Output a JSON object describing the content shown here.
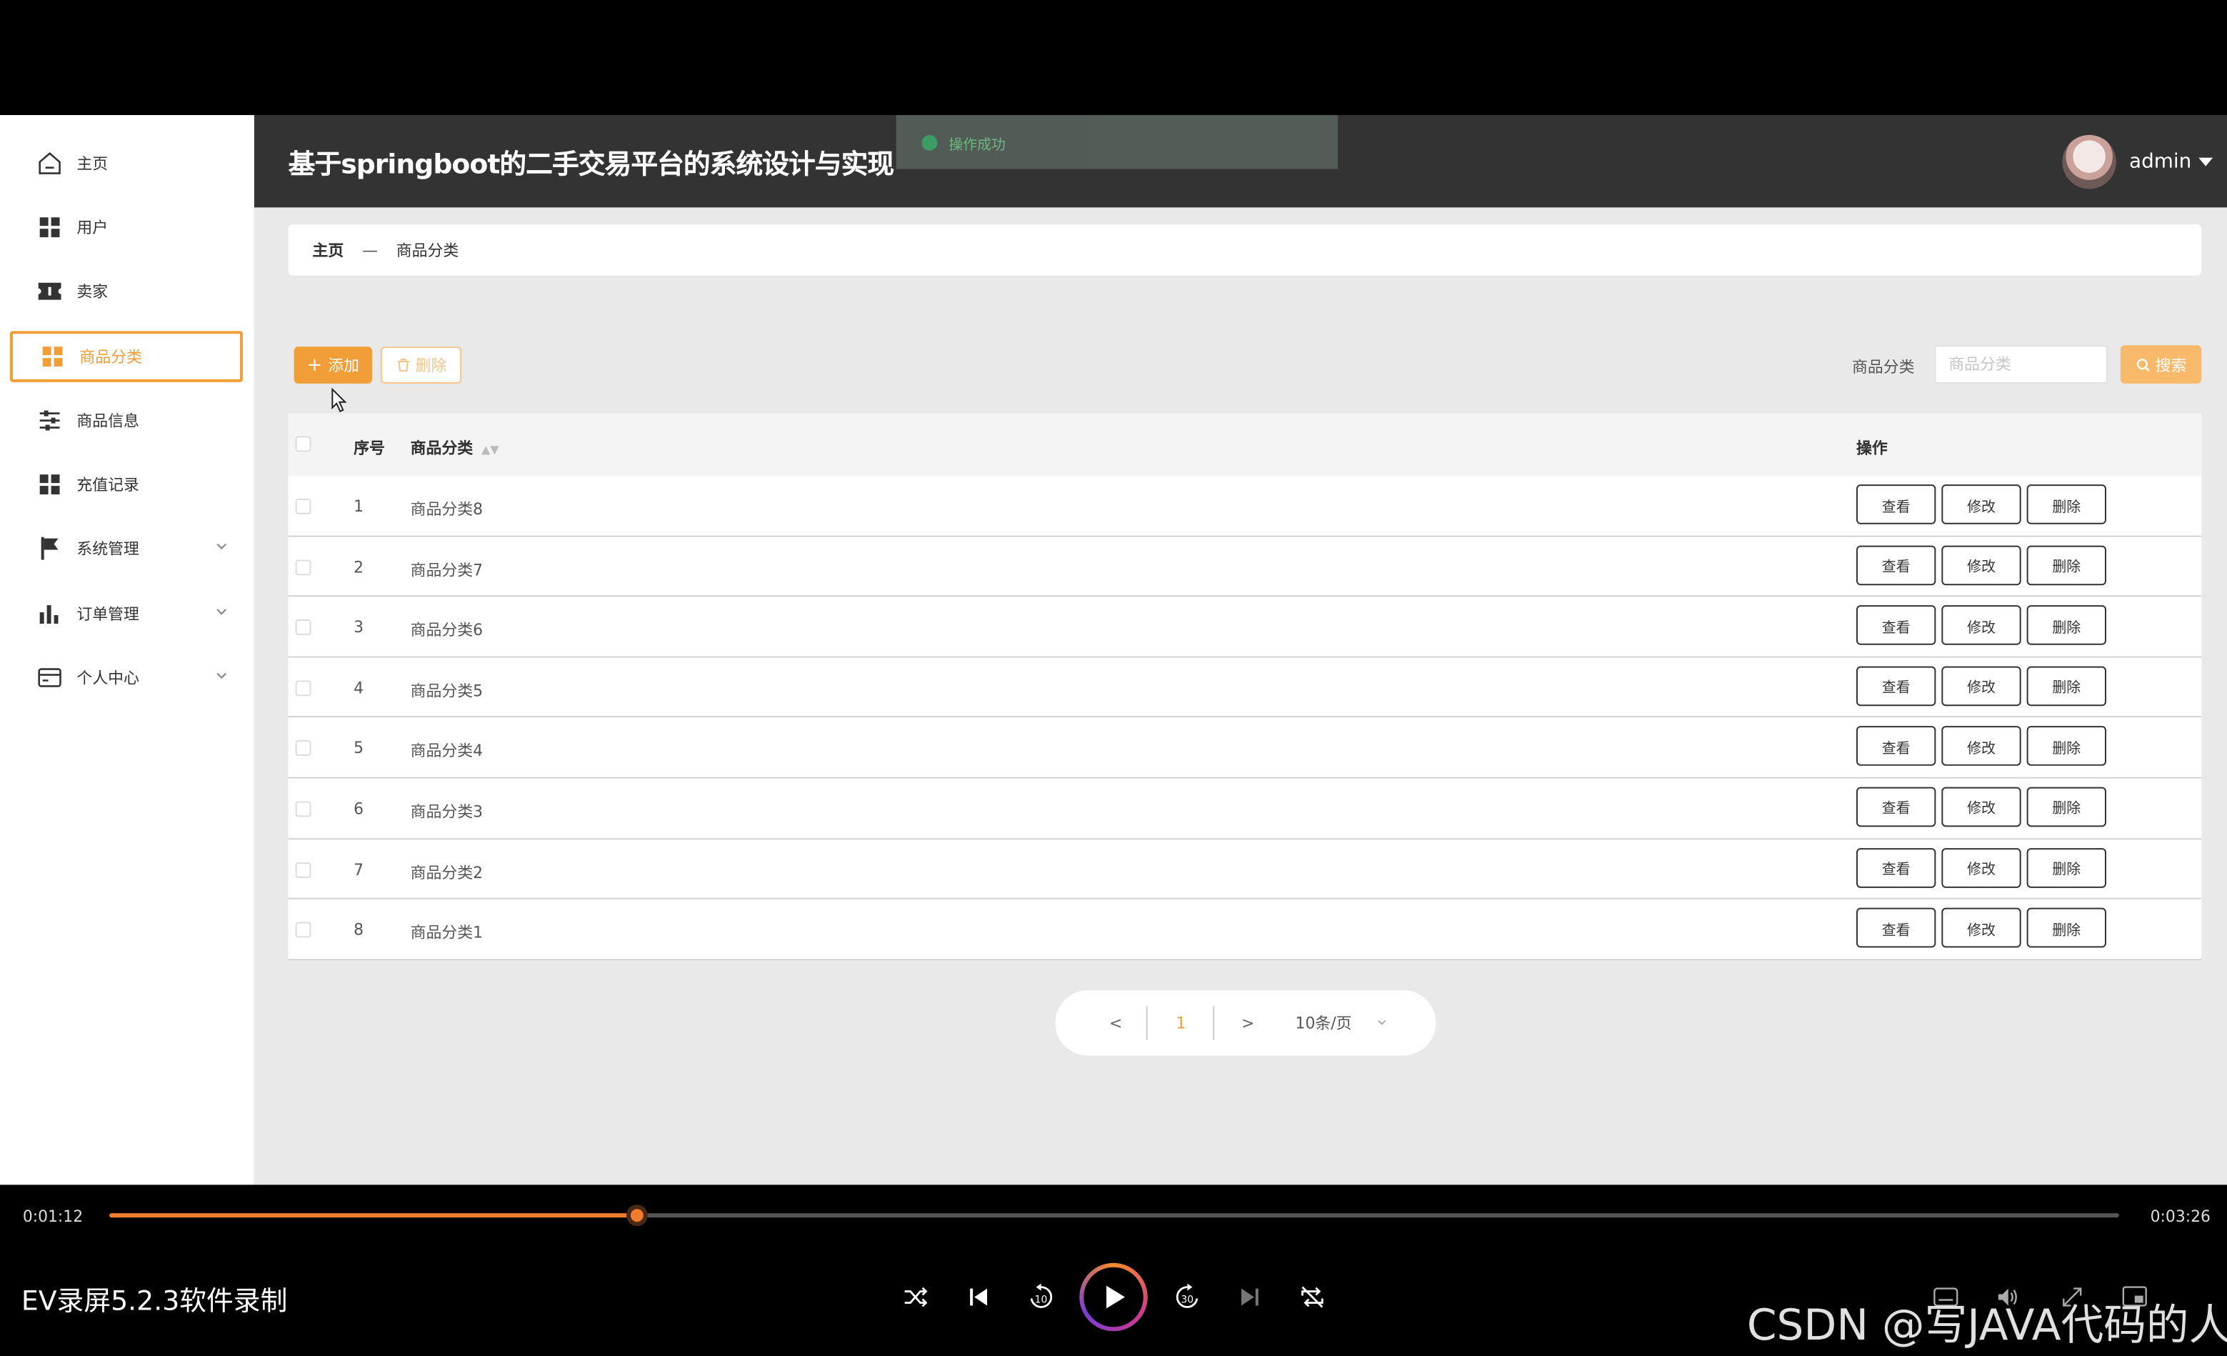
{
  "sidebar": {
    "items": [
      {
        "label": "主页",
        "icon": "home-icon"
      },
      {
        "label": "用户",
        "icon": "grid-icon"
      },
      {
        "label": "卖家",
        "icon": "ticket-icon"
      },
      {
        "label": "商品分类",
        "icon": "grid-icon",
        "active": true
      },
      {
        "label": "商品信息",
        "icon": "sliders-icon"
      },
      {
        "label": "充值记录",
        "icon": "grid-icon"
      },
      {
        "label": "系统管理",
        "icon": "flag-icon",
        "expandable": true
      },
      {
        "label": "订单管理",
        "icon": "bar-chart-icon",
        "expandable": true
      },
      {
        "label": "个人中心",
        "icon": "card-icon",
        "expandable": true
      }
    ]
  },
  "header": {
    "title": "基于springboot的二手交易平台的系统设计与实现",
    "toast": "操作成功",
    "user": "admin"
  },
  "breadcrumb": {
    "home": "主页",
    "separator": "—",
    "current": "商品分类"
  },
  "toolbar": {
    "add_label": "添加",
    "delete_label": "删除",
    "search_label": "商品分类",
    "search_placeholder": "商品分类",
    "search_button": "搜索"
  },
  "table": {
    "headers": {
      "index": "序号",
      "name": "商品分类",
      "ops": "操作"
    },
    "rows": [
      {
        "index": "1",
        "name": "商品分类8"
      },
      {
        "index": "2",
        "name": "商品分类7"
      },
      {
        "index": "3",
        "name": "商品分类6"
      },
      {
        "index": "4",
        "name": "商品分类5"
      },
      {
        "index": "5",
        "name": "商品分类4"
      },
      {
        "index": "6",
        "name": "商品分类3"
      },
      {
        "index": "7",
        "name": "商品分类2"
      },
      {
        "index": "8",
        "name": "商品分类1"
      }
    ],
    "row_actions": {
      "view": "查看",
      "edit": "修改",
      "delete": "删除"
    }
  },
  "pagination": {
    "prev": "<",
    "current": "1",
    "next": ">",
    "page_size": "10条/页"
  },
  "player": {
    "current_time": "0:01:12",
    "total_time": "0:03:26",
    "progress": 0.2625,
    "recorder_label": "EV录屏5.2.3软件录制",
    "watermark": "CSDN @写JAVA代码的人"
  },
  "colors": {
    "accent": "#f19d38",
    "header_bg": "#333333",
    "progress": "#f17c2d"
  }
}
